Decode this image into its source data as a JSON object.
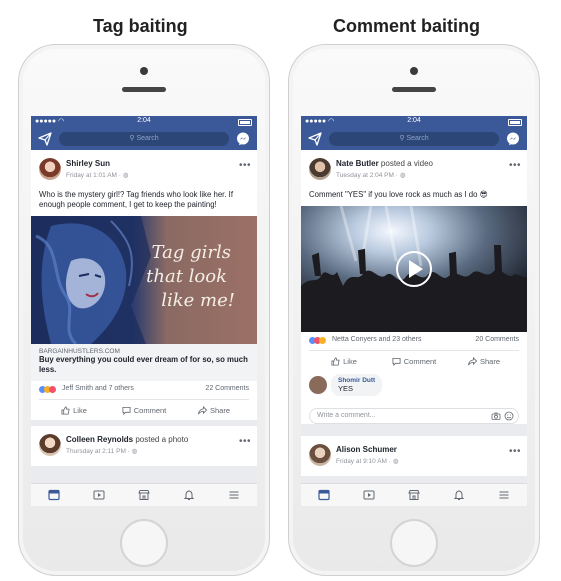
{
  "headings": {
    "left": "Tag baiting",
    "right": "Comment baiting"
  },
  "status_time": "2:04",
  "search_placeholder": "Search",
  "left_phone": {
    "post1": {
      "author": "Shirley Sun",
      "timestamp": "Friday at 1:01 AM ·",
      "text": "Who is the mystery girl!? Tag friends who look like her. If enough people comment, I get to keep the painting!",
      "image_caption_lines": [
        "Tag girls",
        "that look",
        "like me!"
      ],
      "link_domain": "BARGAINHUSTLERS.COM",
      "link_title": "Buy everything you could ever dream of for so, so much less.",
      "reactions_text": "Jeff Smith and 7 others",
      "comments_count": "22 Comments"
    },
    "post2": {
      "author": "Colleen Reynolds",
      "action": "posted a photo",
      "timestamp": "Thursday at 2:11 PM ·"
    }
  },
  "right_phone": {
    "post1": {
      "author": "Nate Butler",
      "action": "posted a video",
      "timestamp": "Tuesday at 2:04 PM ·",
      "text": "Comment \"YES\" if you love rock as much as I do 😎",
      "reactions_text": "Netta Conyers and 23 others",
      "comments_count": "20 Comments",
      "comment": {
        "author": "Shomir Dutt",
        "text": "YES"
      },
      "write_placeholder": "Write a comment..."
    },
    "post2": {
      "author": "Alison Schumer",
      "timestamp": "Friday at 9:10 AM ·"
    }
  },
  "actions": {
    "like": "Like",
    "comment": "Comment",
    "share": "Share"
  },
  "colors": {
    "facebook_blue": "#3b5998",
    "like_blue": "#5890ff",
    "love_red": "#f25268",
    "haha_yellow": "#f7b125"
  },
  "icons": [
    "send-icon",
    "search-icon",
    "messenger-icon",
    "news-feed-icon",
    "video-icon",
    "marketplace-icon",
    "notifications-icon",
    "menu-icon",
    "more-icon",
    "like-icon",
    "comment-icon",
    "share-icon",
    "play-icon",
    "camera-icon",
    "emoji-icon"
  ]
}
